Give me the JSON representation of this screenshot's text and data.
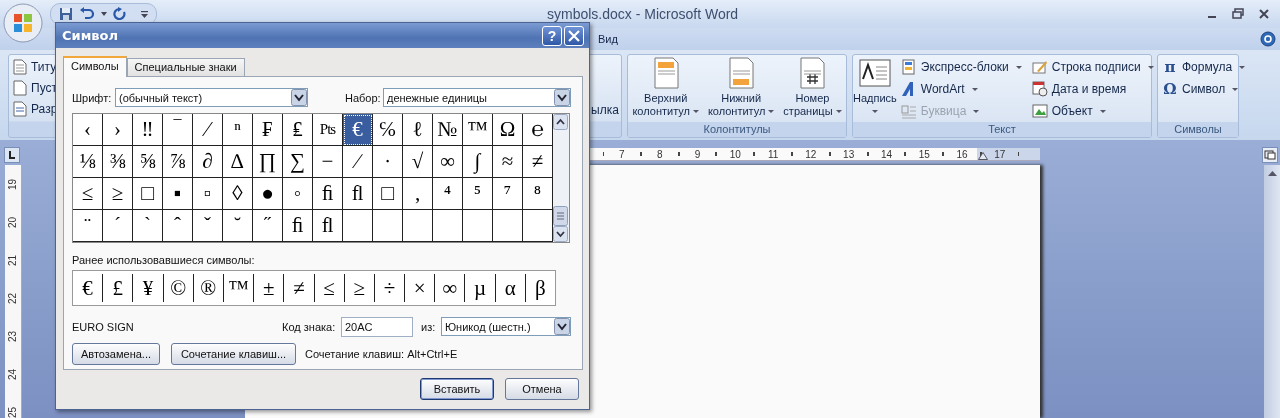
{
  "window": {
    "title": "symbols.docx - Microsoft Word"
  },
  "ribbon_tabs": [
    {
      "label": "Вид",
      "selected": false
    }
  ],
  "ribbon": {
    "left_items": [
      {
        "label": "Титу"
      },
      {
        "label": "Пуст"
      },
      {
        "label": "Разр"
      }
    ],
    "partial_label": "ылка",
    "groups": [
      {
        "label": "Колонтитулы",
        "items": [
          {
            "kind": "large",
            "lines": [
              "Верхний",
              "колонтитул"
            ],
            "menu": true,
            "disabled": false
          },
          {
            "kind": "large",
            "lines": [
              "Нижний",
              "колонтитул"
            ],
            "menu": true,
            "disabled": false
          },
          {
            "kind": "large",
            "lines": [
              "Номер",
              "страницы"
            ],
            "menu": true,
            "disabled": false
          }
        ]
      },
      {
        "label": "Текст",
        "items": [
          {
            "kind": "large",
            "lines": [
              "Надпись"
            ],
            "menu": true,
            "disabled": false
          },
          {
            "kind": "small",
            "label": "Экспресс-блоки",
            "menu": true,
            "disabled": false
          },
          {
            "kind": "small",
            "label": "WordArt",
            "menu": true,
            "disabled": false
          },
          {
            "kind": "small",
            "label": "Буквица",
            "menu": true,
            "disabled": true
          },
          {
            "kind": "small",
            "label": "Строка подписи",
            "menu": true,
            "disabled": false
          },
          {
            "kind": "small",
            "label": "Дата и время",
            "menu": false,
            "disabled": false
          },
          {
            "kind": "small",
            "label": "Объект",
            "menu": true,
            "disabled": false
          }
        ]
      },
      {
        "label": "Символы",
        "items": [
          {
            "kind": "small",
            "glyph": "π",
            "label": "Формула",
            "menu": true,
            "disabled": false
          },
          {
            "kind": "small",
            "glyph": "Ω",
            "label": "Символ",
            "menu": true,
            "disabled": false
          }
        ]
      }
    ]
  },
  "ruler": {
    "horizontal": [
      "7",
      "8",
      "9",
      "10",
      "11",
      "12",
      "13",
      "14",
      "15",
      "16",
      "17"
    ],
    "vertical": [
      "19",
      "20",
      "21",
      "22",
      "23",
      "24",
      "25"
    ]
  },
  "dialog": {
    "title": "Символ",
    "help": "?",
    "tabs": [
      {
        "label": "Символы",
        "selected": true
      },
      {
        "label": "Специальные знаки",
        "selected": false
      }
    ],
    "font": {
      "label": "Шрифт:",
      "value": "(обычный текст)"
    },
    "subset": {
      "label": "Набор:",
      "value": "денежные единицы"
    },
    "grid": [
      [
        {
          "c": "‹",
          "selected": false
        },
        {
          "c": "›",
          "selected": false
        },
        {
          "c": "‼",
          "selected": false
        },
        {
          "c": "‾",
          "selected": false
        },
        {
          "c": "⁄",
          "selected": false
        },
        {
          "c": "ⁿ",
          "selected": false
        },
        {
          "c": "₣",
          "selected": false
        },
        {
          "c": "₤",
          "selected": false
        },
        {
          "c": "Pts",
          "selected": false
        },
        {
          "c": "€",
          "selected": true
        },
        {
          "c": "℅",
          "selected": false
        },
        {
          "c": "ℓ",
          "selected": false
        },
        {
          "c": "№",
          "selected": false
        },
        {
          "c": "™",
          "selected": false
        },
        {
          "c": "Ω",
          "selected": false
        },
        {
          "c": "℮",
          "selected": false
        }
      ],
      [
        {
          "c": "⅛",
          "selected": false
        },
        {
          "c": "⅜",
          "selected": false
        },
        {
          "c": "⅝",
          "selected": false
        },
        {
          "c": "⅞",
          "selected": false
        },
        {
          "c": "∂",
          "selected": false
        },
        {
          "c": "∆",
          "selected": false
        },
        {
          "c": "∏",
          "selected": false
        },
        {
          "c": "∑",
          "selected": false
        },
        {
          "c": "−",
          "selected": false
        },
        {
          "c": "∕",
          "selected": false
        },
        {
          "c": "∙",
          "selected": false
        },
        {
          "c": "√",
          "selected": false
        },
        {
          "c": "∞",
          "selected": false
        },
        {
          "c": "∫",
          "selected": false
        },
        {
          "c": "≈",
          "selected": false
        },
        {
          "c": "≠",
          "selected": false
        }
      ],
      [
        {
          "c": "≤",
          "selected": false
        },
        {
          "c": "≥",
          "selected": false
        },
        {
          "c": "□",
          "selected": false
        },
        {
          "c": "▪",
          "selected": false
        },
        {
          "c": "▫",
          "selected": false
        },
        {
          "c": "◊",
          "selected": false
        },
        {
          "c": "●",
          "selected": false
        },
        {
          "c": "◦",
          "selected": false
        },
        {
          "c": "ﬁ",
          "selected": false
        },
        {
          "c": "ﬂ",
          "selected": false
        },
        {
          "c": "□",
          "selected": false
        },
        {
          "c": "‚",
          "selected": false
        },
        {
          "c": "⁴",
          "selected": false
        },
        {
          "c": "⁵",
          "selected": false
        },
        {
          "c": "⁷",
          "selected": false
        },
        {
          "c": "⁸",
          "selected": false
        }
      ],
      [
        {
          "c": "¨",
          "selected": false
        },
        {
          "c": "ˊ",
          "selected": false
        },
        {
          "c": "ˋ",
          "selected": false
        },
        {
          "c": "ˆ",
          "selected": false
        },
        {
          "c": "ˇ",
          "selected": false
        },
        {
          "c": "˘",
          "selected": false
        },
        {
          "c": "˝",
          "selected": false
        },
        {
          "c": "ﬁ",
          "selected": false
        },
        {
          "c": "ﬂ",
          "selected": false
        },
        {
          "selected": false
        },
        {
          "selected": false
        },
        {
          "selected": false
        },
        {
          "selected": false
        },
        {
          "selected": false
        },
        {
          "selected": false
        },
        {
          "selected": false
        }
      ]
    ],
    "recent_label": "Ранее использовавшиеся символы:",
    "recent": [
      "€",
      "£",
      "¥",
      "©",
      "®",
      "™",
      "±",
      "≠",
      "≤",
      "≥",
      "÷",
      "×",
      "∞",
      "µ",
      "α",
      "β"
    ],
    "char_name": "EURO SIGN",
    "code": {
      "label": "Код знака:",
      "value": "20AC"
    },
    "from": {
      "label": "из:",
      "value": "Юникод (шестн.)"
    },
    "buttons": [
      "Автозамена...",
      "Сочетание клавиш..."
    ],
    "shortcut": "Сочетание клавиш: Alt+Ctrl+E",
    "actions": [
      {
        "label": "Вставить",
        "default": true
      },
      {
        "label": "Отмена",
        "default": false
      }
    ]
  }
}
